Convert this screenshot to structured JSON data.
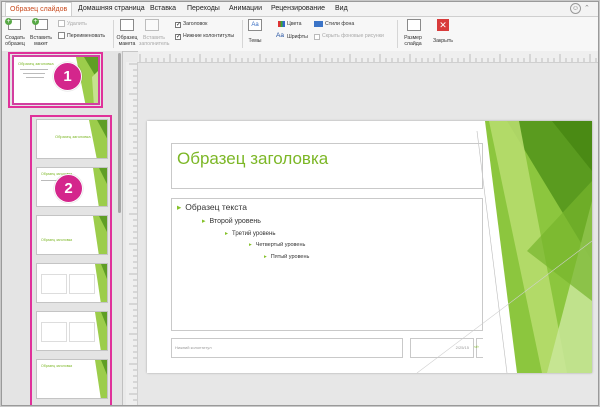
{
  "tabs": [
    {
      "label": "Образец слайдов",
      "active": true
    },
    {
      "label": "Домашняя страница"
    },
    {
      "label": "Вставка"
    },
    {
      "label": "Переходы"
    },
    {
      "label": "Анимации"
    },
    {
      "label": "Рецензирование"
    },
    {
      "label": "Вид"
    }
  ],
  "ribbon": {
    "create_sample": [
      "Создать",
      "образец"
    ],
    "insert_layout": [
      "Вставить",
      "макет"
    ],
    "delete": "Удалить",
    "rename": "Переименовать",
    "sample_layout": [
      "Образец",
      "макета"
    ],
    "insert_placeholder": [
      "Вставить",
      "заполнитель"
    ],
    "title_check": "Заголовок",
    "footers_check": "Нижние колонтитулы",
    "themes": "Темы",
    "colors": "Цвета",
    "fonts": "Шрифты",
    "fonts_icon_text": "Аа",
    "bg_styles": "Стили фона",
    "hide_bg": "Скрыть фоновые рисунки",
    "slide_size": [
      "Размер",
      "слайда"
    ],
    "close": "Закрыть"
  },
  "callouts": [
    "1",
    "2"
  ],
  "slide": {
    "title": "Образец заголовка",
    "levels": [
      "Образец текста",
      "Второй уровень",
      "Третий уровень",
      "Четвертый уровень",
      "Пятый уровень"
    ],
    "footer": "Нижний колонтитул",
    "date": "2/25/15",
    "page": "‹#›"
  },
  "colors": {
    "accent": "#c8491d",
    "green": "#7cb726",
    "magenta": "#e0319a",
    "callout": "#d4268c"
  }
}
